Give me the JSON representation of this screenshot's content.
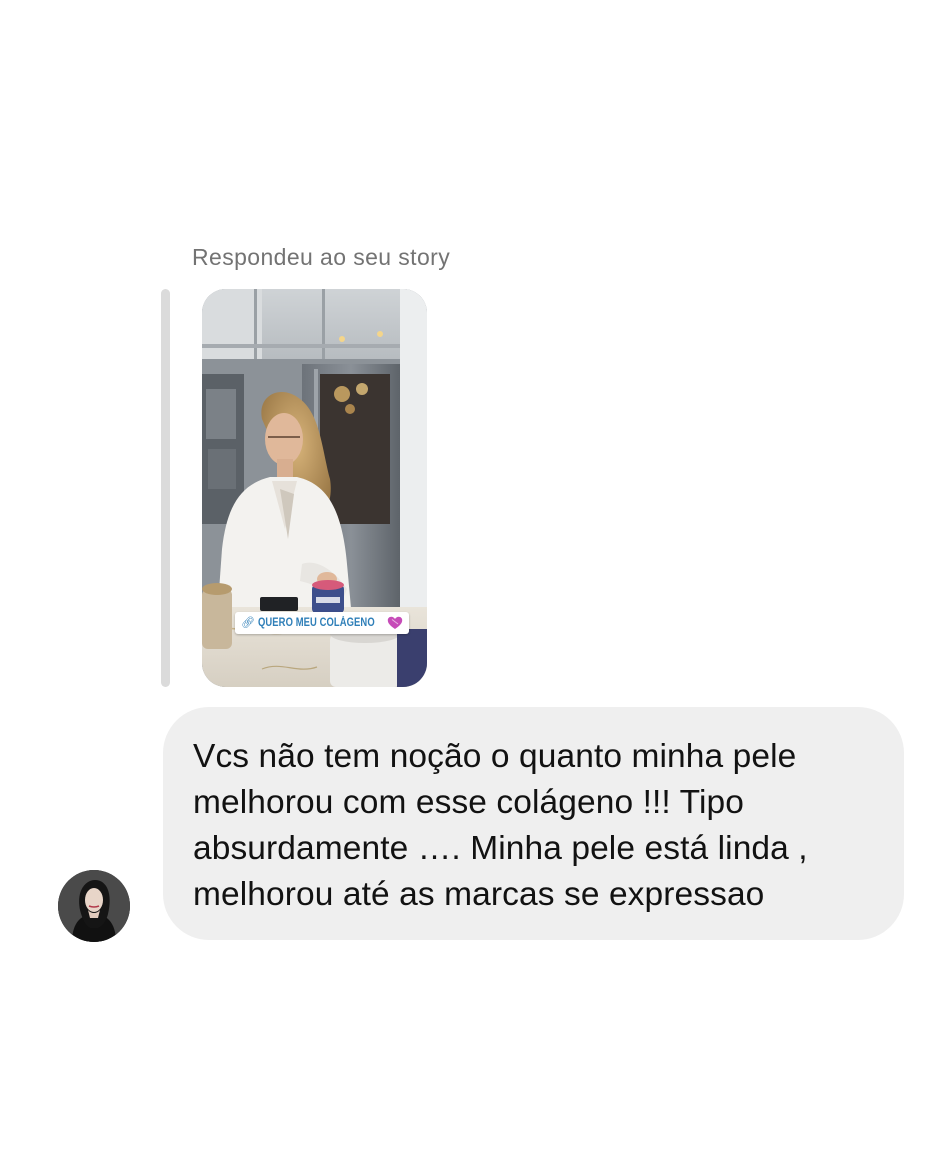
{
  "reply": {
    "caption": "Respondeu ao seu story",
    "story_sticker": {
      "label": "QUERO MEU COLÁGENO",
      "link_icon": "link-icon",
      "emoji_icon": "purple-heart-icon"
    }
  },
  "message": {
    "text": "Vcs não tem noção o quanto minha pele melhorou com esse colágeno !!! Tipo absurdamente …. Minha pele está linda , melhorou até as marcas se expressao"
  },
  "sender": {
    "avatar_icon": "profile-photo"
  },
  "colors": {
    "bubble_background": "#efefef",
    "caption_text": "#737373",
    "quote_bar": "#dbdbdb",
    "message_text": "#121212",
    "sticker_text": "#2f7fb8"
  }
}
